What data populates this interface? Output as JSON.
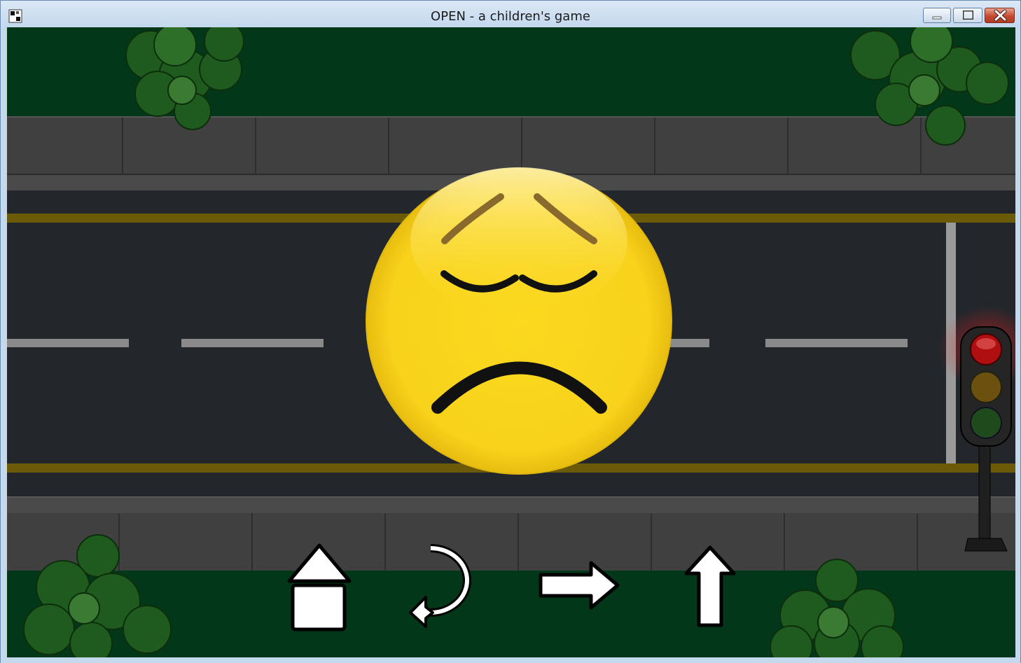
{
  "window": {
    "title": "OPEN - a children's game",
    "controls": [
      "minimize",
      "maximize",
      "close"
    ]
  },
  "scene": {
    "kind": "road-crossing",
    "traffic_light_state": "red",
    "face_expression": "sad"
  },
  "controls": [
    {
      "name": "home-button",
      "icon": "home-icon"
    },
    {
      "name": "back-button",
      "icon": "undo-arrow-icon"
    },
    {
      "name": "next-button",
      "icon": "right-arrow-icon"
    },
    {
      "name": "up-button",
      "icon": "up-arrow-icon"
    }
  ],
  "colors": {
    "grass": "#033719",
    "sidewalk": "#404040",
    "road": "#23272b",
    "yellow_line": "#6b5a08",
    "face": "#fbd51f",
    "red_light": "#b00f12"
  }
}
